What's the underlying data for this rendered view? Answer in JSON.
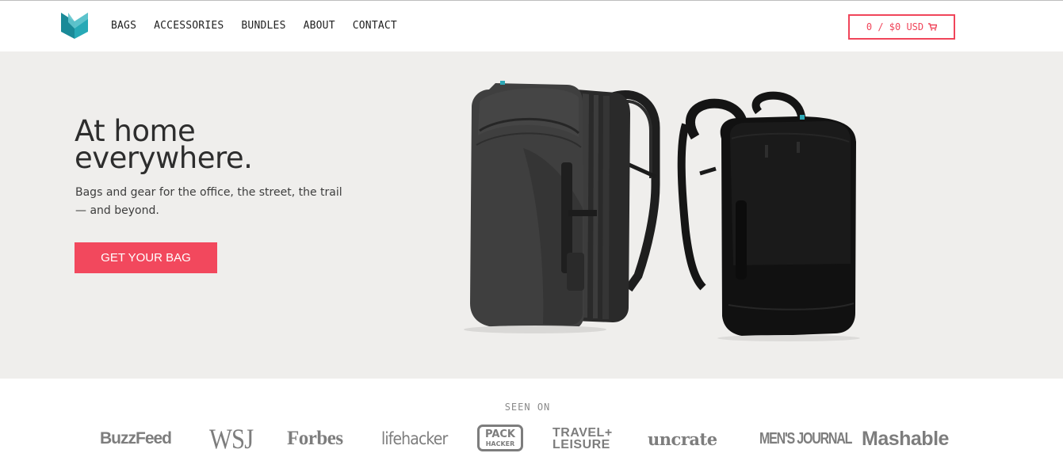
{
  "header": {
    "logo_icon": "brand-logo-icon",
    "nav": [
      {
        "label": "BAGS"
      },
      {
        "label": "ACCESSORIES"
      },
      {
        "label": "BUNDLES"
      },
      {
        "label": "ABOUT"
      },
      {
        "label": "CONTACT"
      }
    ],
    "cart": {
      "label": "0 / $0 USD",
      "icon": "cart-icon"
    }
  },
  "hero": {
    "title_line1": "At home",
    "title_line2": "everywhere.",
    "subtitle": "Bags and gear for the office, the street, the trail — and beyond.",
    "cta": "GET YOUR BAG",
    "image_icon": "backpacks-image"
  },
  "press": {
    "heading": "SEEN ON",
    "logos": {
      "buzzfeed": "BuzzFeed",
      "wsj": "WSJ",
      "forbes": "Forbes",
      "lifehacker": "lifehacker",
      "packhacker_line1": "PACK",
      "packhacker_line2": "HACKER",
      "travel_line1": "TRAVEL+",
      "travel_line2": "LEISURE",
      "uncrate": "uncrate",
      "mensjournal": "MEN'S JOURNAL",
      "mashable": "Mashable"
    }
  },
  "colors": {
    "accent": "#f2485d",
    "hero_bg": "#efeeec",
    "logo_teal": "#1a9aa8",
    "logo_light": "#5fc3cd",
    "press_gray": "#7d7d7d"
  }
}
